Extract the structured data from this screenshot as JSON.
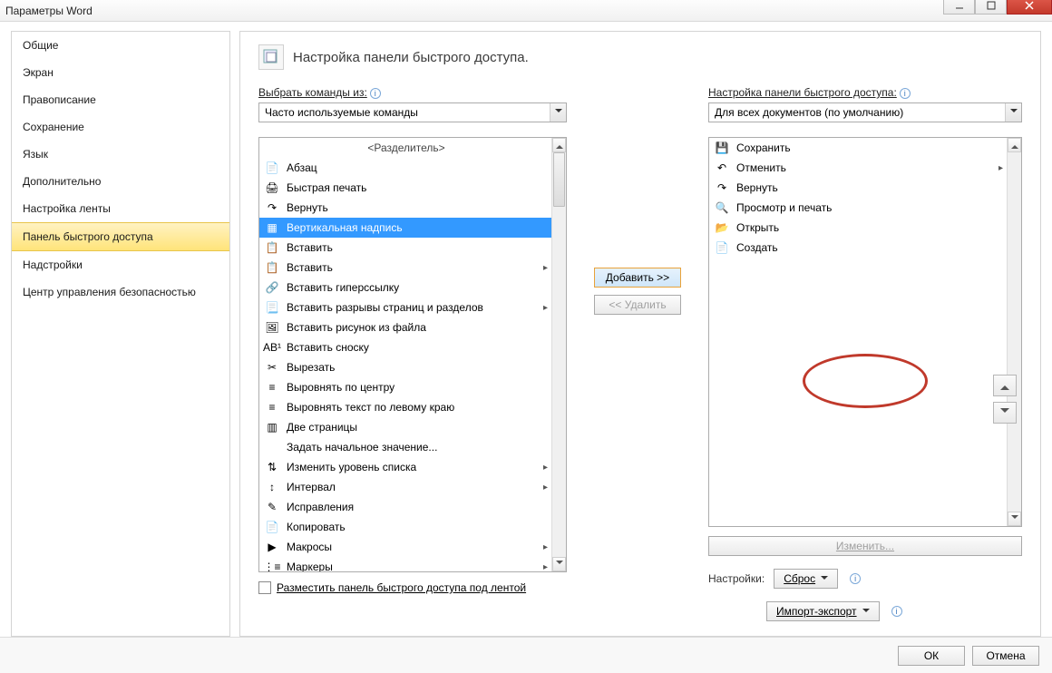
{
  "title": "Параметры Word",
  "sidebar": {
    "items": [
      {
        "label": "Общие"
      },
      {
        "label": "Экран"
      },
      {
        "label": "Правописание"
      },
      {
        "label": "Сохранение"
      },
      {
        "label": "Язык"
      },
      {
        "label": "Дополнительно"
      },
      {
        "label": "Настройка ленты"
      },
      {
        "label": "Панель быстрого доступа"
      },
      {
        "label": "Надстройки"
      },
      {
        "label": "Центр управления безопасностью"
      }
    ],
    "selected": 7
  },
  "header": "Настройка панели быстрого доступа.",
  "left": {
    "label": "Выбрать команды из:",
    "combo": "Часто используемые команды",
    "separator": "<Разделитель>",
    "items": [
      {
        "icon": "📄",
        "label": "Абзац"
      },
      {
        "icon": "🖨",
        "label": "Быстрая печать"
      },
      {
        "icon": "↷",
        "label": "Вернуть"
      },
      {
        "icon": "▦",
        "label": "Вертикальная надпись",
        "selected": true
      },
      {
        "icon": "📋",
        "label": "Вставить"
      },
      {
        "icon": "📋",
        "label": "Вставить",
        "arrow": true
      },
      {
        "icon": "🔗",
        "label": "Вставить гиперссылку"
      },
      {
        "icon": "📃",
        "label": "Вставить разрывы страниц и разделов",
        "arrow": true
      },
      {
        "icon": "🖼",
        "label": "Вставить рисунок из файла"
      },
      {
        "icon": "AB¹",
        "label": "Вставить сноску"
      },
      {
        "icon": "✂",
        "label": "Вырезать"
      },
      {
        "icon": "≡",
        "label": "Выровнять по центру"
      },
      {
        "icon": "≡",
        "label": "Выровнять текст по левому краю"
      },
      {
        "icon": "▥",
        "label": "Две страницы"
      },
      {
        "icon": "",
        "label": "Задать начальное значение..."
      },
      {
        "icon": "⇅",
        "label": "Изменить уровень списка",
        "arrow": true
      },
      {
        "icon": "↕",
        "label": "Интервал",
        "arrow": true
      },
      {
        "icon": "✎",
        "label": "Исправления"
      },
      {
        "icon": "📄",
        "label": "Копировать"
      },
      {
        "icon": "▶",
        "label": "Макросы",
        "arrow": true
      },
      {
        "icon": "⋮≡",
        "label": "Маркеры",
        "arrow": true
      }
    ]
  },
  "mid": {
    "add": "Добавить >>",
    "remove": "<< Удалить"
  },
  "right": {
    "label": "Настройка панели быстрого доступа:",
    "combo": "Для всех документов (по умолчанию)",
    "items": [
      {
        "icon": "💾",
        "label": "Сохранить"
      },
      {
        "icon": "↶",
        "label": "Отменить",
        "arrow": true
      },
      {
        "icon": "↷",
        "label": "Вернуть"
      },
      {
        "icon": "🔍",
        "label": "Просмотр и печать"
      },
      {
        "icon": "📂",
        "label": "Открыть"
      },
      {
        "icon": "📄",
        "label": "Создать"
      }
    ],
    "modify": "Изменить...",
    "settings_label": "Настройки:",
    "reset": "Сброс",
    "import": "Импорт-экспорт"
  },
  "lower_check": "Разместить панель быстрого доступа под лентой",
  "footer": {
    "ok": "ОК",
    "cancel": "Отмена"
  }
}
